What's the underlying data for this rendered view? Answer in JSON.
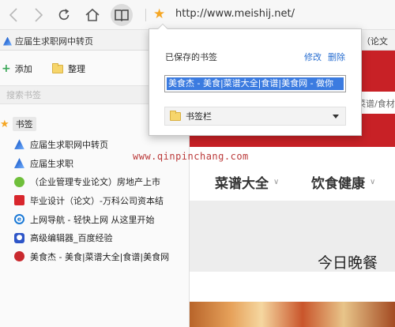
{
  "toolbar": {
    "url": "http://www.meishij.net/",
    "icons": [
      "back-icon",
      "forward-icon",
      "reload-icon",
      "home-icon",
      "reader-icon",
      "star-icon"
    ]
  },
  "bookmark_bar": {
    "items": [
      {
        "label": "应届生求职网中转页",
        "icon": "triangle-site-icon"
      },
      {
        "label": "（论文",
        "icon": ""
      }
    ]
  },
  "sidebar": {
    "add_label": "添加",
    "organize_label": "整理",
    "search_placeholder": "搜索书签",
    "root_label": "书签",
    "items": [
      {
        "label": "应届生求职网中转页",
        "icon": "triangle-site-icon"
      },
      {
        "label": "应届生求职",
        "icon": "triangle-site-icon"
      },
      {
        "label": "（企业管理专业论文）房地产上市",
        "icon": "green-circle-icon"
      },
      {
        "label": "毕业设计（论文）-万科公司资本结",
        "icon": "red-square-icon"
      },
      {
        "label": "上网导航 - 轻快上网 从这里开始",
        "icon": "ie-icon"
      },
      {
        "label": "高级编辑器_百度经验",
        "icon": "paw-icon"
      },
      {
        "label": "美食杰 - 美食|菜谱大全|食谱|美食网",
        "icon": "meishij-icon"
      }
    ]
  },
  "popup": {
    "title": "已保存的书签",
    "edit_label": "修改",
    "delete_label": "删除",
    "name_value": "美食杰 - 美食|菜谱大全|食谱|美食网 - 做你",
    "folder_value": "书签栏"
  },
  "page": {
    "search_hint": "菜谱/食材",
    "watermark": "www.qinpinchang.com",
    "nav": [
      "菜谱大全",
      "饮食健康"
    ],
    "headline": "今日晚餐"
  },
  "colors": {
    "banner_red": "#c82126",
    "star_orange": "#f5a623",
    "link_blue": "#2a6fd1",
    "selection_blue": "#3b7be0"
  }
}
